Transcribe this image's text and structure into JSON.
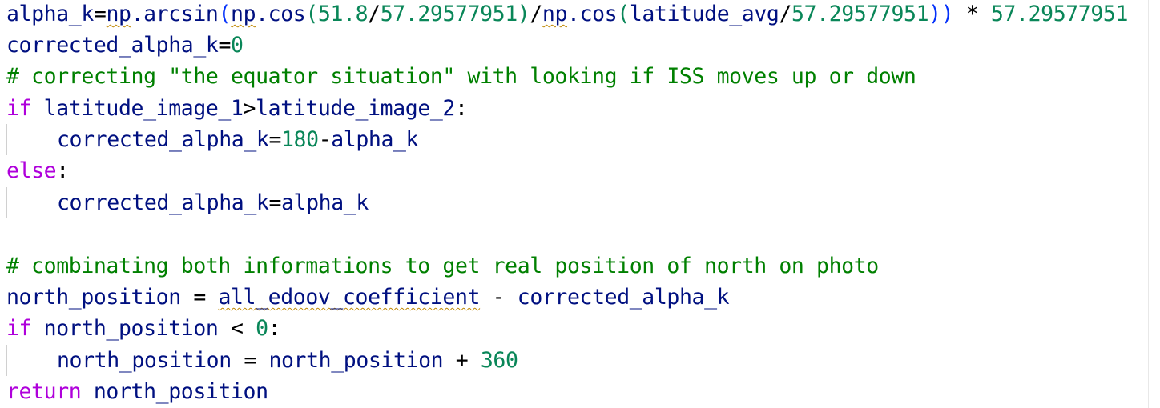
{
  "editor": {
    "lines": [
      {
        "tokens": [
          "alpha_k",
          "=",
          "np",
          ".arcsin",
          "(",
          "np",
          ".cos",
          "(",
          "51.8",
          "/",
          "57.29577951",
          ")",
          "/",
          "np",
          ".cos",
          "(",
          "latitude_avg",
          "/",
          "57.29577951",
          "))",
          " * ",
          "57.29577951"
        ]
      },
      {
        "tokens": [
          "corrected_alpha_k",
          "=",
          "0"
        ]
      },
      {
        "tokens": [
          "# correcting \"the equator situation\" with looking if ISS moves up or down"
        ]
      },
      {
        "tokens": [
          "if",
          " latitude_image_1",
          ">",
          "latitude_image_2",
          ":"
        ]
      },
      {
        "tokens": [
          "corrected_alpha_k",
          "=",
          "180",
          "-",
          "alpha_k"
        ]
      },
      {
        "tokens": [
          "else",
          ":"
        ]
      },
      {
        "tokens": [
          "corrected_alpha_k",
          "=",
          "alpha_k"
        ]
      },
      {
        "tokens": []
      },
      {
        "tokens": [
          "# combinating both informations to get real position of north on photo"
        ]
      },
      {
        "tokens": [
          "north_position",
          " = ",
          "all_edoov_coefficient",
          " - ",
          "corrected_alpha_k"
        ]
      },
      {
        "tokens": [
          "if",
          " north_position",
          " < ",
          "0",
          ":"
        ]
      },
      {
        "tokens": [
          "north_position",
          " = ",
          "north_position",
          " + ",
          "360"
        ]
      },
      {
        "tokens": [
          "return",
          " north_position"
        ]
      }
    ]
  },
  "colors": {
    "background": "#ffffff",
    "identifier": "#001080",
    "keyword": "#af00db",
    "number": "#098658",
    "comment": "#008000",
    "operator": "#000000",
    "bracket": "#0431fa",
    "warning_squiggle": "#bf8803",
    "indent_guide": "#d0d0d0"
  }
}
